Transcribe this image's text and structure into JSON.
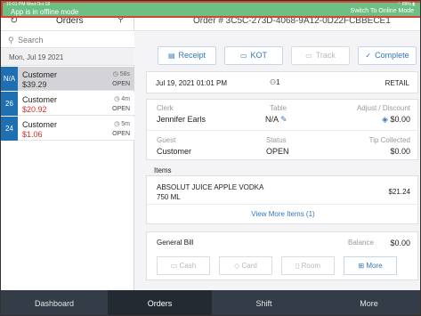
{
  "status_bar": {
    "time": "10:01 PM   Wed Oct 18",
    "right": "⌃  89%  ▮"
  },
  "offline_banner": {
    "message": "App is in offline mode",
    "switch_label": "Switch To Online Mode"
  },
  "sidebar": {
    "title": "Orders",
    "search_placeholder": "Search",
    "date_group": "Mon, Jul 19 2021",
    "orders": [
      {
        "tag": "N/A",
        "name": "Customer",
        "amount": "$39.29",
        "elapsed": "58s",
        "state": "OPEN",
        "amount_color": "normal"
      },
      {
        "tag": "26",
        "name": "Customer",
        "amount": "$20.92",
        "elapsed": "4m",
        "state": "OPEN",
        "amount_color": "red"
      },
      {
        "tag": "24",
        "name": "Customer",
        "amount": "$1.06",
        "elapsed": "5m",
        "state": "OPEN",
        "amount_color": "red"
      }
    ]
  },
  "main": {
    "order_title": "Order # 3C5C-273D-4068-9A12-0D22FCBBECE1",
    "actions": {
      "receipt": "Receipt",
      "kot": "KOT",
      "track": "Track",
      "complete": "Complete"
    },
    "info": {
      "datetime": "Jul 19, 2021 01:01 PM",
      "guests": "1",
      "order_type": "RETAIL"
    },
    "details": {
      "clerk_label": "Clerk",
      "clerk_value": "Jennifer Earls",
      "table_label": "Table",
      "table_value": "N/A",
      "adjust_label": "Adjust / Discount",
      "adjust_value": "$0.00",
      "guest_label": "Guest",
      "guest_value": "Customer",
      "status_label": "Status",
      "status_value": "OPEN",
      "tip_label": "Tip Collected",
      "tip_value": "$0.00"
    },
    "items": {
      "label": "Items",
      "line1": "ABSOLUT JUICE APPLE VODKA",
      "line2": "750 ML",
      "price": "$21.24",
      "more_link": "View More Items (1)"
    },
    "bill": {
      "title": "General Bill",
      "balance_label": "Balance",
      "balance_value": "$0.00",
      "cash": "Cash",
      "card": "Card",
      "room": "Room",
      "more": "More"
    }
  },
  "bottom_nav": {
    "dashboard": "Dashboard",
    "orders": "Orders",
    "shift": "Shift",
    "more": "More"
  },
  "colors": {
    "banner_green": "#6cc084",
    "banner_border": "#e0412e",
    "accent_blue": "#2f78bd",
    "tag_blue": "#1f6fb3",
    "alert_red": "#d0312d",
    "nav_bg": "#333c47",
    "nav_active": "#242a32"
  }
}
